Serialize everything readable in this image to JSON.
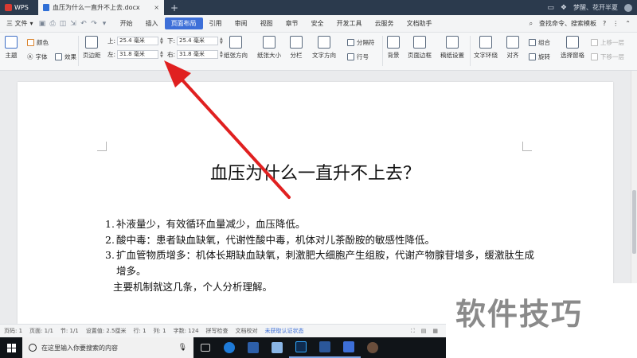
{
  "titlebar": {
    "app_name": "WPS",
    "doc_tab": "血压为什么一直升不上去.docx",
    "close_glyph": "×",
    "new_tab": "+",
    "user_name": "梦醒、花开半夏",
    "icons": [
      "window-mode-icon",
      "skin-icon",
      "user-avatar"
    ]
  },
  "menubar": {
    "file_label": "三 文件",
    "tabs": [
      "开始",
      "插入",
      "页面布局",
      "引用",
      "审阅",
      "视图",
      "章节",
      "安全",
      "开发工具",
      "云服务",
      "文档助手"
    ],
    "active_tab": "页面布局",
    "search_label": "查找命令、搜索模板",
    "help_glyph": "?",
    "collapse_glyph": "⌃"
  },
  "ribbon": {
    "theme": "主题",
    "color": "颜色",
    "font": "字体",
    "effect": "效果",
    "margins": "页边距",
    "top_label": "上:",
    "top_value": "25.4 毫米",
    "bottom_label": "下:",
    "bottom_value": "25.4 毫米",
    "left_label": "左:",
    "left_value": "31.8 毫米",
    "right_label": "右:",
    "right_value": "31.8 毫米",
    "orientation": "纸张方向",
    "paper_size": "纸张大小",
    "columns": "分栏",
    "text_direction": "文字方向",
    "breaks": "分隔符",
    "line_numbers": "行号",
    "background": "背景",
    "page_border": "页面边框",
    "draft_setup": "稿纸设置",
    "text_wrap": "文字环绕",
    "align": "对齐",
    "group": "组合",
    "rotate": "旋转",
    "selection_pane": "选择窗格",
    "bring_forward": "上移一层",
    "send_backward": "下移一层"
  },
  "document": {
    "title": "血压为什么一直升不上去？",
    "items": [
      {
        "num": "1.",
        "text": "补液量少，有效循环血量减少，血压降低。"
      },
      {
        "num": "2.",
        "text": "酸中毒：患者缺血缺氧，代谢性酸中毒，机体对儿茶酚胺的敏感性降低。"
      },
      {
        "num": "3.",
        "text": "扩血管物质增多：机体长期缺血缺氧，刺激肥大细胞产生组胺，代谢产物腺苷增多，缓激肽生成增多。"
      }
    ],
    "summary": "主要机制就这几条，个人分析理解。"
  },
  "statusbar": {
    "page": "页码: 1",
    "pages": "页面: 1/1",
    "section": "节: 1/1",
    "position": "设置值: 2.5厘米",
    "row": "行: 1",
    "col": "列: 1",
    "word_count": "字数: 124",
    "spell_check": "拼写检查",
    "doc_proof": "文档校对",
    "verify": "未获取认证状态"
  },
  "taskbar": {
    "search_placeholder": "在这里输入你要搜索的内容",
    "apps": [
      "task-view",
      "edge",
      "windows-settings",
      "notepad",
      "photoshop",
      "word",
      "wps-writer",
      "avatar-app"
    ]
  },
  "watermark": {
    "text": "软件技巧"
  },
  "colors": {
    "titlebar": "#2b3a4d",
    "accent": "#3d6fd8",
    "arrow": "#e02020",
    "taskbar": "#101418"
  }
}
